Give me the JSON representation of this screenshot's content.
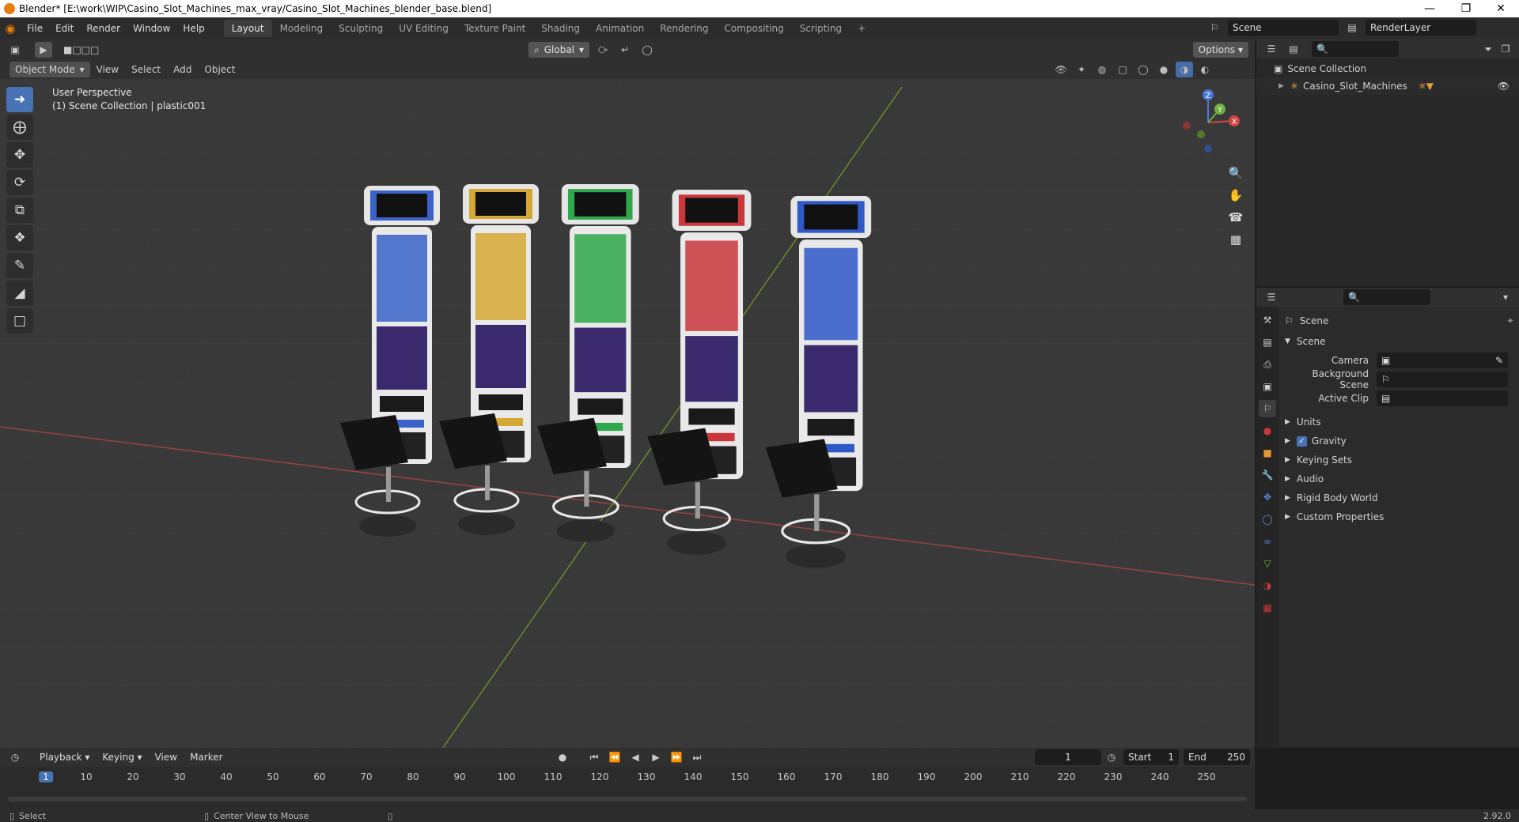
{
  "window": {
    "title": "Blender* [E:\\work\\WIP\\Casino_Slot_Machines_max_vray/Casino_Slot_Machines_blender_base.blend]",
    "controls": [
      "minimize-icon",
      "restore-icon",
      "close-icon"
    ]
  },
  "menu": [
    "File",
    "Edit",
    "Render",
    "Window",
    "Help"
  ],
  "workspaces": [
    "Layout",
    "Modeling",
    "Sculpting",
    "UV Editing",
    "Texture Paint",
    "Shading",
    "Animation",
    "Rendering",
    "Compositing",
    "Scripting"
  ],
  "active_workspace": "Layout",
  "scene_field": "Scene",
  "render_layer_field": "RenderLayer",
  "viewport": {
    "mode": "Object Mode",
    "menus": [
      "View",
      "Select",
      "Add",
      "Object"
    ],
    "transform_orientation": "Global",
    "options_label": "Options",
    "overlay_line1": "User Perspective",
    "overlay_line2": "(1) Scene Collection | plastic001",
    "gizmo_axes": [
      "Z",
      "Y",
      "X"
    ],
    "machine_colors": [
      "#3a63c9",
      "#d4a834",
      "#2fa84b",
      "#c9373b",
      "#2f58c9"
    ]
  },
  "tools": [
    "select-box-icon",
    "cursor-icon",
    "move-icon",
    "rotate-icon",
    "scale-icon",
    "transform-icon",
    "annotate-icon",
    "measure-icon",
    "add-cube-icon"
  ],
  "outliner": {
    "root": "Scene Collection",
    "items": [
      "Casino_Slot_Machines"
    ]
  },
  "properties": {
    "context_title": "Scene",
    "section": "Scene",
    "fields": [
      {
        "label": "Camera",
        "value": ""
      },
      {
        "label": "Background Scene",
        "value": ""
      },
      {
        "label": "Active Clip",
        "value": ""
      }
    ],
    "panels": [
      "Units",
      "Gravity",
      "Keying Sets",
      "Audio",
      "Rigid Body World",
      "Custom Properties"
    ],
    "gravity_checked": true
  },
  "timeline": {
    "menus": [
      "Playback",
      "Keying",
      "View",
      "Marker"
    ],
    "current_frame": "1",
    "start_label": "Start",
    "start": "1",
    "end_label": "End",
    "end": "250",
    "ticks": [
      "1",
      "10",
      "20",
      "30",
      "40",
      "50",
      "60",
      "70",
      "80",
      "90",
      "100",
      "110",
      "120",
      "130",
      "140",
      "150",
      "160",
      "170",
      "180",
      "190",
      "200",
      "210",
      "220",
      "230",
      "240",
      "250"
    ]
  },
  "statusbar": {
    "select": "Select",
    "center_view": "Center View to Mouse",
    "version": "2.92.0"
  }
}
